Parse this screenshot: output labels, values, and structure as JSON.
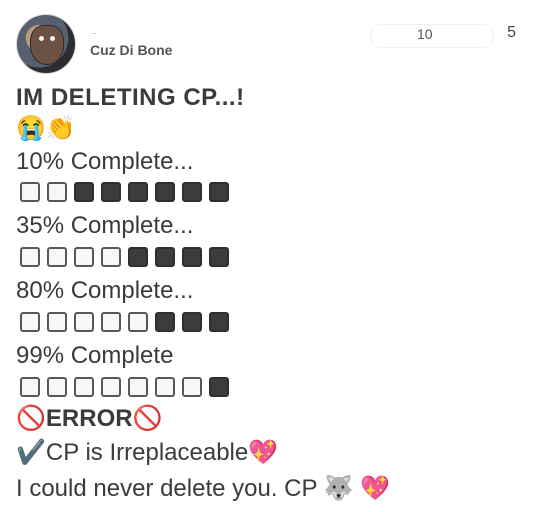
{
  "header": {
    "top_small_text": "...",
    "username": "Cuz Di Bone",
    "count": "10",
    "more_label": "5"
  },
  "post": {
    "heading": "IM DELETING CP...!",
    "emojis": [
      "😭",
      "👏"
    ],
    "progress": [
      {
        "label": "10% Complete...",
        "value": 0.1,
        "filled_count": 6
      },
      {
        "label": "35% Complete...",
        "value": 0.35,
        "filled_count": 4
      },
      {
        "label": "80% Complete...",
        "value": 0.8,
        "filled_count": 3
      },
      {
        "label": "99% Complete",
        "value": 0.99,
        "filled_count": 1
      }
    ],
    "error": {
      "prefix_icon": "🚫",
      "text": "ERROR",
      "suffix_icon": "🚫"
    },
    "irreplaceable": {
      "prefix_icon": "✔️",
      "text": "CP is Irreplaceable",
      "suffix_icon": "💖"
    },
    "final_line": {
      "text": "I could never delete you. CP",
      "cat_icon": "🐺",
      "heart_icon": "💖"
    }
  },
  "colors": {
    "text": "#3b3b3b",
    "filled_square": "#3c3c3c",
    "empty_square": "#f7f7f7"
  }
}
